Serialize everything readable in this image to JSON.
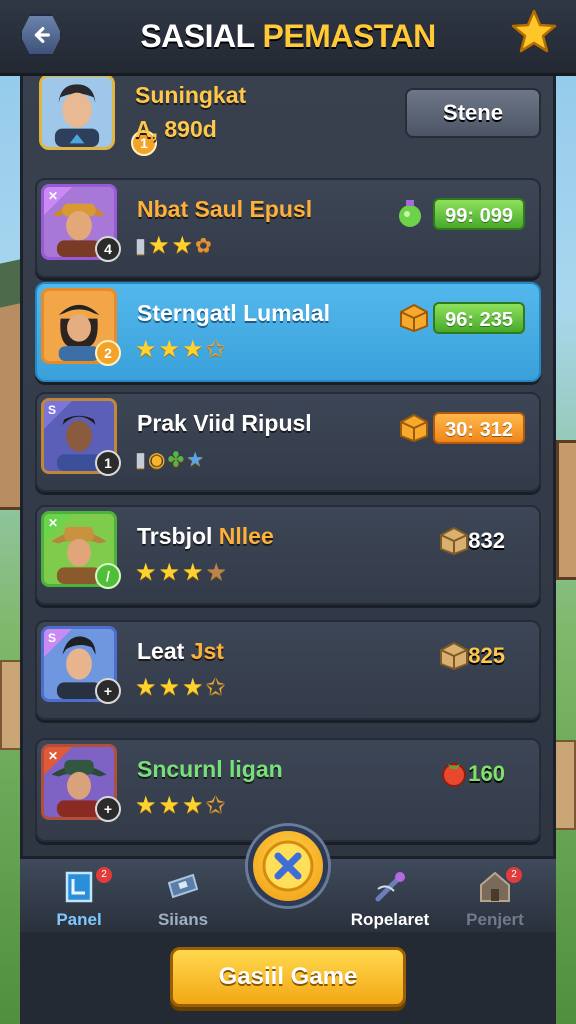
{
  "header": {
    "title_part1": "SASIAL ",
    "title_part2": "PEMASTAN",
    "back_icon": "back-arrow-icon",
    "star_icon": "star-icon"
  },
  "player": {
    "name": "Suningkat",
    "subtitle": "A, 890d",
    "badge": "1",
    "button_label": "Stene"
  },
  "rows": [
    {
      "name": "Nbat Saul Epusl",
      "rank": "4",
      "score": "99: 099",
      "score_style": "green",
      "resource_icon": "potion-icon"
    },
    {
      "name": "Sterngatl Lumalal",
      "rank": "2",
      "score": "96: 235",
      "score_style": "green",
      "resource_icon": "chest-icon"
    },
    {
      "name": "Prak Viid Ripusl",
      "rank": "1",
      "score": "30: 312",
      "score_style": "orange",
      "resource_icon": "chest-icon"
    },
    {
      "name_part1": "Trsbjol ",
      "name_part2": "Nllee",
      "score": "832",
      "resource_icon": "crate-icon"
    },
    {
      "name_part1": "Leat ",
      "name_part2": "Jst",
      "score": "825",
      "resource_icon": "crate-icon"
    },
    {
      "name": "Sncurnl ligan",
      "score": "160",
      "resource_icon": "tomato-icon"
    }
  ],
  "tabs": [
    {
      "label": "Panel",
      "badge": "2",
      "icon": "panel-icon"
    },
    {
      "label": "Siians",
      "icon": "ticket-icon"
    },
    {
      "label": "Ropelaret",
      "icon": "wand-icon"
    },
    {
      "label": "Penjert",
      "badge": "2",
      "icon": "house-icon"
    }
  ],
  "center_button_icon": "close-x-icon",
  "main_button": "Gasiil Game",
  "colors": {
    "accent": "#ffc938",
    "highlight_row": "#4ab0e6",
    "score_green": "#5cc236",
    "score_orange": "#f39a2a"
  }
}
